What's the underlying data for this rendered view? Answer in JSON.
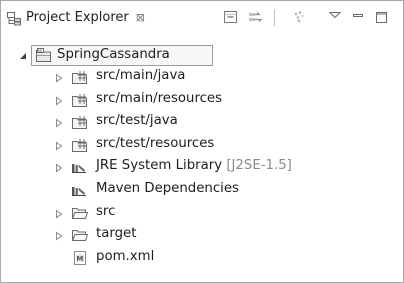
{
  "view": {
    "title": "Project Explorer",
    "close_glyph": "⊠",
    "icon": "project-explorer-icon"
  },
  "toolbar": {
    "collapse_all": "collapse-all-icon",
    "link_editor": "link-with-editor-icon",
    "filter": "filter-icon",
    "view_menu": "view-menu-icon",
    "minimize": "minimize-icon",
    "maximize": "maximize-icon"
  },
  "tree": {
    "project": {
      "label": "SpringCassandra",
      "expanded": true
    },
    "items": [
      {
        "label": "src/main/java",
        "decoration": "",
        "icon": "source-folder-icon",
        "expandable": true
      },
      {
        "label": "src/main/resources",
        "decoration": "",
        "icon": "source-folder-icon",
        "expandable": true
      },
      {
        "label": "src/test/java",
        "decoration": "",
        "icon": "source-folder-icon",
        "expandable": true
      },
      {
        "label": "src/test/resources",
        "decoration": "",
        "icon": "source-folder-icon",
        "expandable": true
      },
      {
        "label": "JRE System Library",
        "decoration": "[J2SE-1.5]",
        "icon": "library-icon",
        "expandable": true
      },
      {
        "label": "Maven Dependencies",
        "decoration": "",
        "icon": "library-icon",
        "expandable": false
      },
      {
        "label": "src",
        "decoration": "",
        "icon": "folder-icon",
        "expandable": true
      },
      {
        "label": "target",
        "decoration": "",
        "icon": "folder-icon",
        "expandable": true
      },
      {
        "label": "pom.xml",
        "decoration": "",
        "icon": "maven-pom-file-icon",
        "expandable": false
      }
    ]
  }
}
